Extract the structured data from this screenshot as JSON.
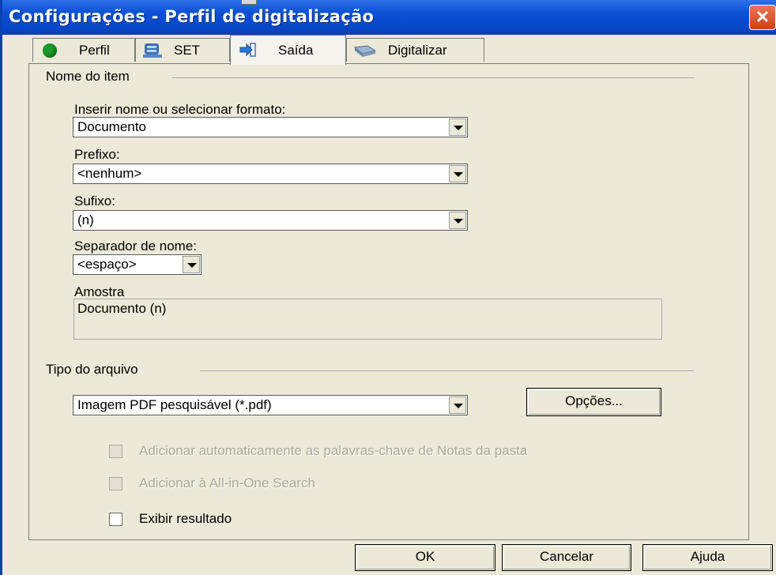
{
  "window": {
    "title": "Configurações - Perfil de digitalização",
    "close_label": "✕"
  },
  "tabs": [
    {
      "label": "Perfil",
      "icon": "green-circle-icon",
      "color": "#1a9a2a"
    },
    {
      "label": "SET",
      "icon": "set-icon"
    },
    {
      "label": "Saída",
      "icon": "output-arrow-icon",
      "active": true
    },
    {
      "label": "Digitalizar",
      "icon": "scanner-icon"
    }
  ],
  "item_name": {
    "group_label": "Nome do item",
    "format": {
      "label": "Inserir nome ou selecionar formato:",
      "value": "Documento"
    },
    "prefix": {
      "label": "Prefixo:",
      "value": "<nenhum>"
    },
    "suffix": {
      "label": "Sufixo:",
      "value": "(n)"
    },
    "separator": {
      "label": "Separador de nome:",
      "value": "<espaço>"
    },
    "sample": {
      "label": "Amostra",
      "value": "Documento (n)"
    }
  },
  "file_type": {
    "group_label": "Tipo do arquivo",
    "value": "Imagem PDF pesquisável (*.pdf)",
    "options_button": "Opções..."
  },
  "checkboxes": [
    {
      "label": "Adicionar automaticamente as palavras-chave de Notas da pasta",
      "checked": false,
      "enabled": false
    },
    {
      "label": "Adicionar à All-in-One Search",
      "checked": false,
      "enabled": false
    },
    {
      "label": "Exibir resultado",
      "checked": false,
      "enabled": true
    }
  ],
  "buttons": {
    "ok": "OK",
    "cancel": "Cancelar",
    "help": "Ajuda"
  }
}
